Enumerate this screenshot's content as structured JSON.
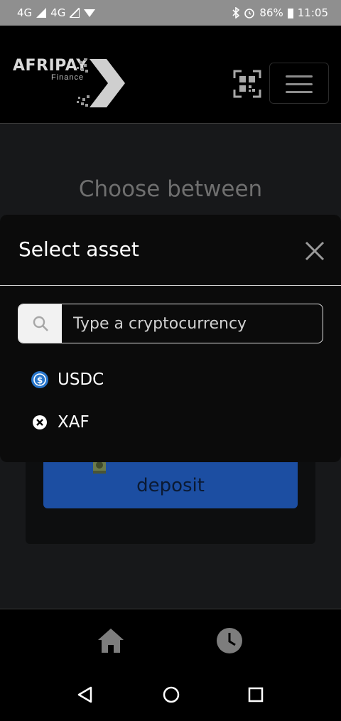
{
  "status_bar": {
    "network_1": "4G",
    "network_2": "4G",
    "battery": "86%",
    "time": "11:05"
  },
  "header": {
    "logo_name": "AFRIPAY",
    "logo_sub": "Finance",
    "qr_icon": "qr-scan-icon",
    "menu_icon": "hamburger-icon"
  },
  "background": {
    "heading": "Choose between",
    "deposit_label": "deposit"
  },
  "modal": {
    "title": "Select asset",
    "search_placeholder": "Type a cryptocurrency",
    "assets": [
      {
        "label": "USDC",
        "icon": "usdc-icon"
      },
      {
        "label": "XAF",
        "icon": "xaf-icon"
      }
    ]
  },
  "bottom_nav": {
    "items": [
      "home-icon",
      "history-icon"
    ]
  },
  "colors": {
    "accent": "#1c4ea2",
    "usdc": "#2775ca"
  }
}
